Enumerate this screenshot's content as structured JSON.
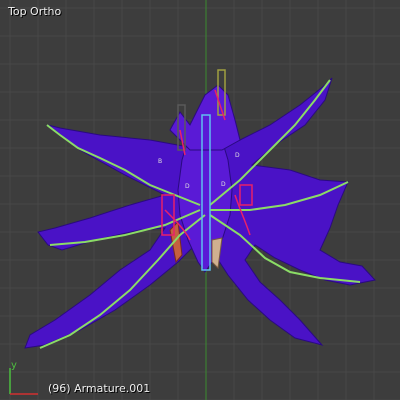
{
  "viewport": {
    "view_name": "Top Ortho",
    "object_info": "(96) Armature.001"
  },
  "axis_gizmo": {
    "y_label": "y",
    "y_color": "#4dbf40",
    "x_color": "#d23030"
  },
  "colors": {
    "background": "#3d3d3d",
    "grid": "#484848",
    "mesh_fill": "#4a12c6",
    "mesh_edge": "#2a0a80",
    "bone": "#8bdc66",
    "bone_constraint": "#e8206a",
    "y_axis_line": "#3a8a30",
    "x_axis_line": "#8a3a3a"
  },
  "bone_labels": [
    "D",
    "D",
    "D",
    "B"
  ]
}
